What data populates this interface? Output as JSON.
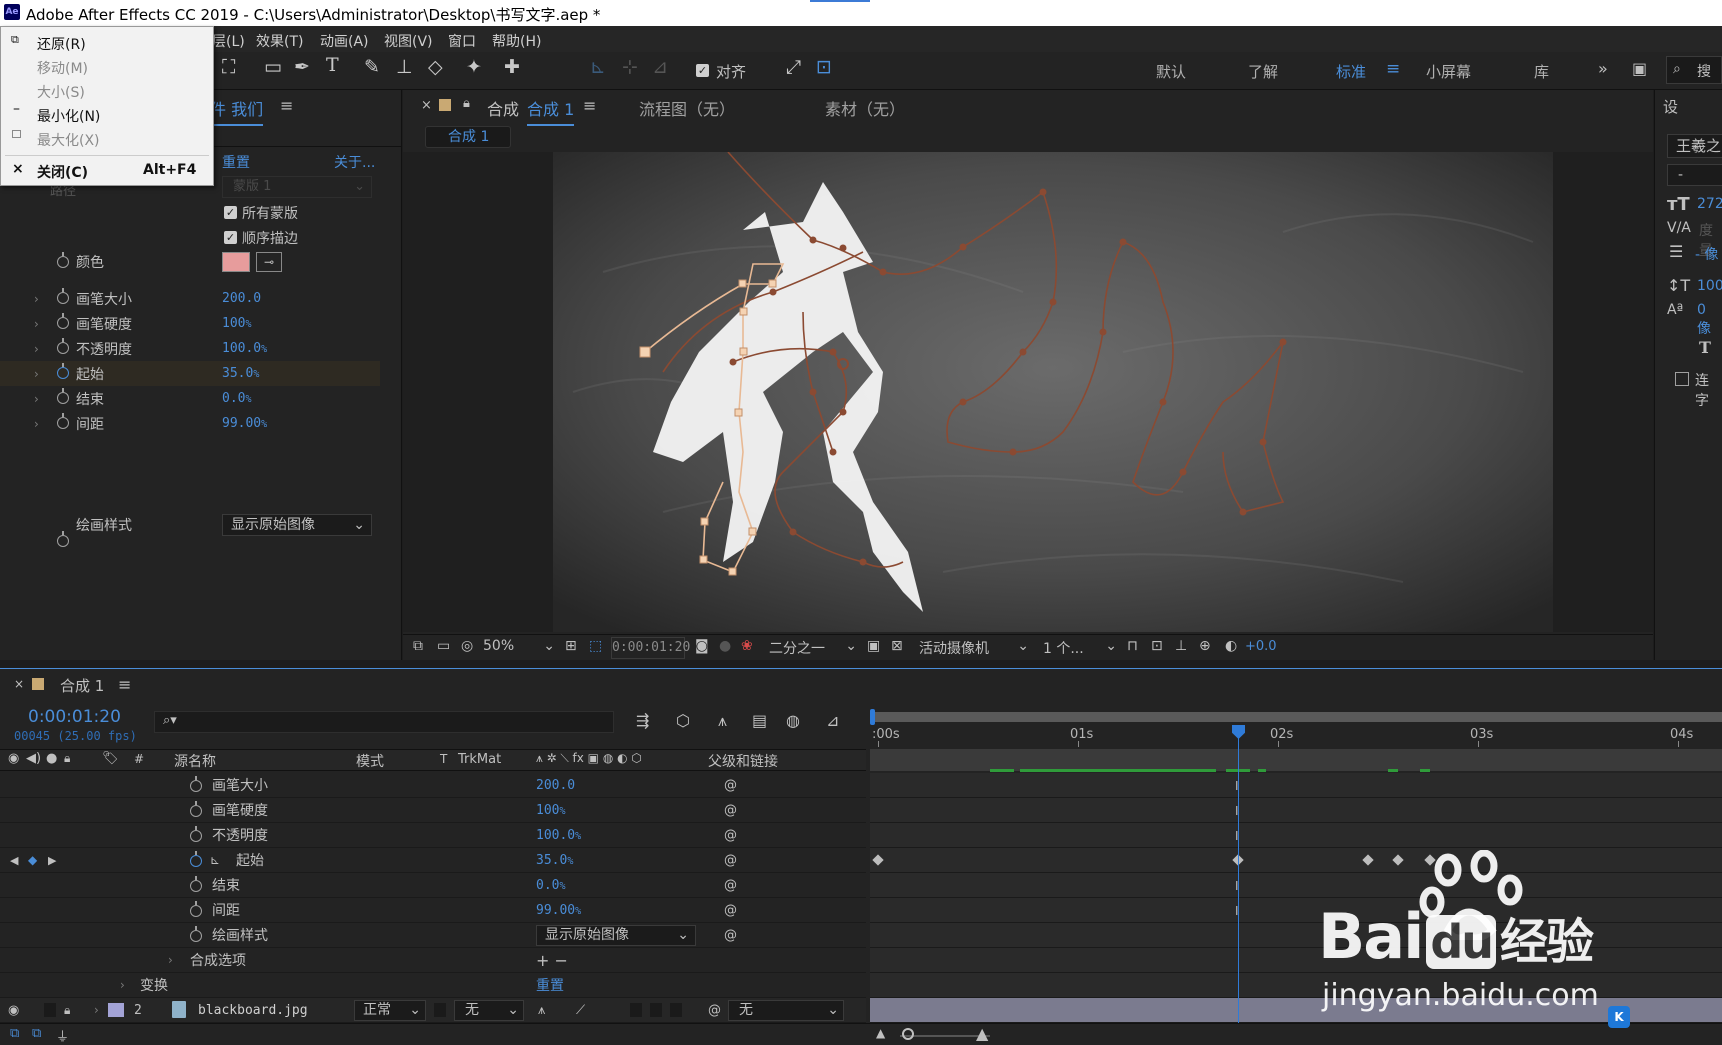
{
  "titlebar": {
    "app_icon": "Ae",
    "title": "Adobe After Effects CC 2019 - C:\\Users\\Administrator\\Desktop\\书写文字.aep *"
  },
  "menubar": {
    "items": [
      "层(L)",
      "效果(T)",
      "动画(A)",
      "视图(V)",
      "窗口",
      "帮助(H)"
    ]
  },
  "system_menu": {
    "restore": "还原(R)",
    "move": "移动(M)",
    "size": "大小(S)",
    "minimize": "最小化(N)",
    "maximize": "最大化(X)",
    "close": "关闭(C)",
    "close_shortcut": "Alt+F4"
  },
  "toolbar": {
    "snap_label": "对齐",
    "workspaces": [
      "默认",
      "了解",
      "标准",
      "小屏幕",
      "库"
    ],
    "active_workspace": "标准",
    "search_label": "搜"
  },
  "effect_panel": {
    "tab_title": "件 我们",
    "reset": "重置",
    "about": "关于...",
    "path_label": "路径",
    "path_value": "蒙版 1",
    "all_masks": "所有蒙版",
    "sequential": "顺序描边",
    "color_label": "颜色",
    "color_value": "#e79c9c",
    "props": [
      {
        "label": "画笔大小",
        "value": "200.0",
        "unit": ""
      },
      {
        "label": "画笔硬度",
        "value": "100",
        "unit": "%"
      },
      {
        "label": "不透明度",
        "value": "100.0",
        "unit": "%"
      },
      {
        "label": "起始",
        "value": "35.0",
        "unit": "%"
      },
      {
        "label": "结束",
        "value": "0.0",
        "unit": "%"
      },
      {
        "label": "间距",
        "value": "99.00",
        "unit": "%"
      }
    ],
    "paint_style_label": "绘画样式",
    "paint_style_value": "显示原始图像"
  },
  "comp_panel": {
    "tab_prefix": "合成",
    "tab_name": "合成 1",
    "flow_tab": "流程图（无）",
    "footage_tab": "素材（无）",
    "sub_tab": "合成 1",
    "zoom": "50%",
    "timecode": "0:00:01:20",
    "resolution": "二分之一",
    "camera": "活动摄像机",
    "views": "1 个...",
    "exposure": "+0.0"
  },
  "char_panel": {
    "title": "设",
    "font": "王羲之",
    "style": "-",
    "size": "272",
    "tracking_label": "度量",
    "leading": "- 像",
    "vscale": "100",
    "baseline": "0 像",
    "bold": "T",
    "ligature": "连字"
  },
  "timeline": {
    "tab": "合成 1",
    "timecode": "0:00:01:20",
    "fps": "00045 (25.00 fps)",
    "columns": {
      "source": "源名称",
      "mode": "模式",
      "t": "T",
      "trkmat": "TrkMat",
      "parent": "父级和链接"
    },
    "props": [
      {
        "label": "画笔大小",
        "value": "200.0",
        "unit": ""
      },
      {
        "label": "画笔硬度",
        "value": "100",
        "unit": "%"
      },
      {
        "label": "不透明度",
        "value": "100.0",
        "unit": "%"
      },
      {
        "label": "起始",
        "value": "35.0",
        "unit": "%"
      },
      {
        "label": "结束",
        "value": "0.0",
        "unit": "%"
      },
      {
        "label": "间距",
        "value": "99.00",
        "unit": "%"
      }
    ],
    "paint_style_label": "绘画样式",
    "paint_style_value": "显示原始图像",
    "comp_options": "合成选项",
    "add_remove": "+ −",
    "transform": "变换",
    "transform_reset": "重置",
    "layer": {
      "num": "2",
      "name": "blackboard.jpg",
      "mode": "正常",
      "trkmat": "无",
      "parent": "无",
      "color": "#a3a3d6"
    },
    "ruler": [
      ":00s",
      "01s",
      "02s",
      "03s",
      "04s"
    ],
    "current_time_sec": 1.8,
    "keyframes_sec": [
      0,
      1.8,
      2.45,
      2.6,
      2.76
    ]
  },
  "watermark": {
    "brand": "Bai",
    "brand2": "du",
    "suffix": "经验",
    "url": "jingyan.baidu.com"
  }
}
